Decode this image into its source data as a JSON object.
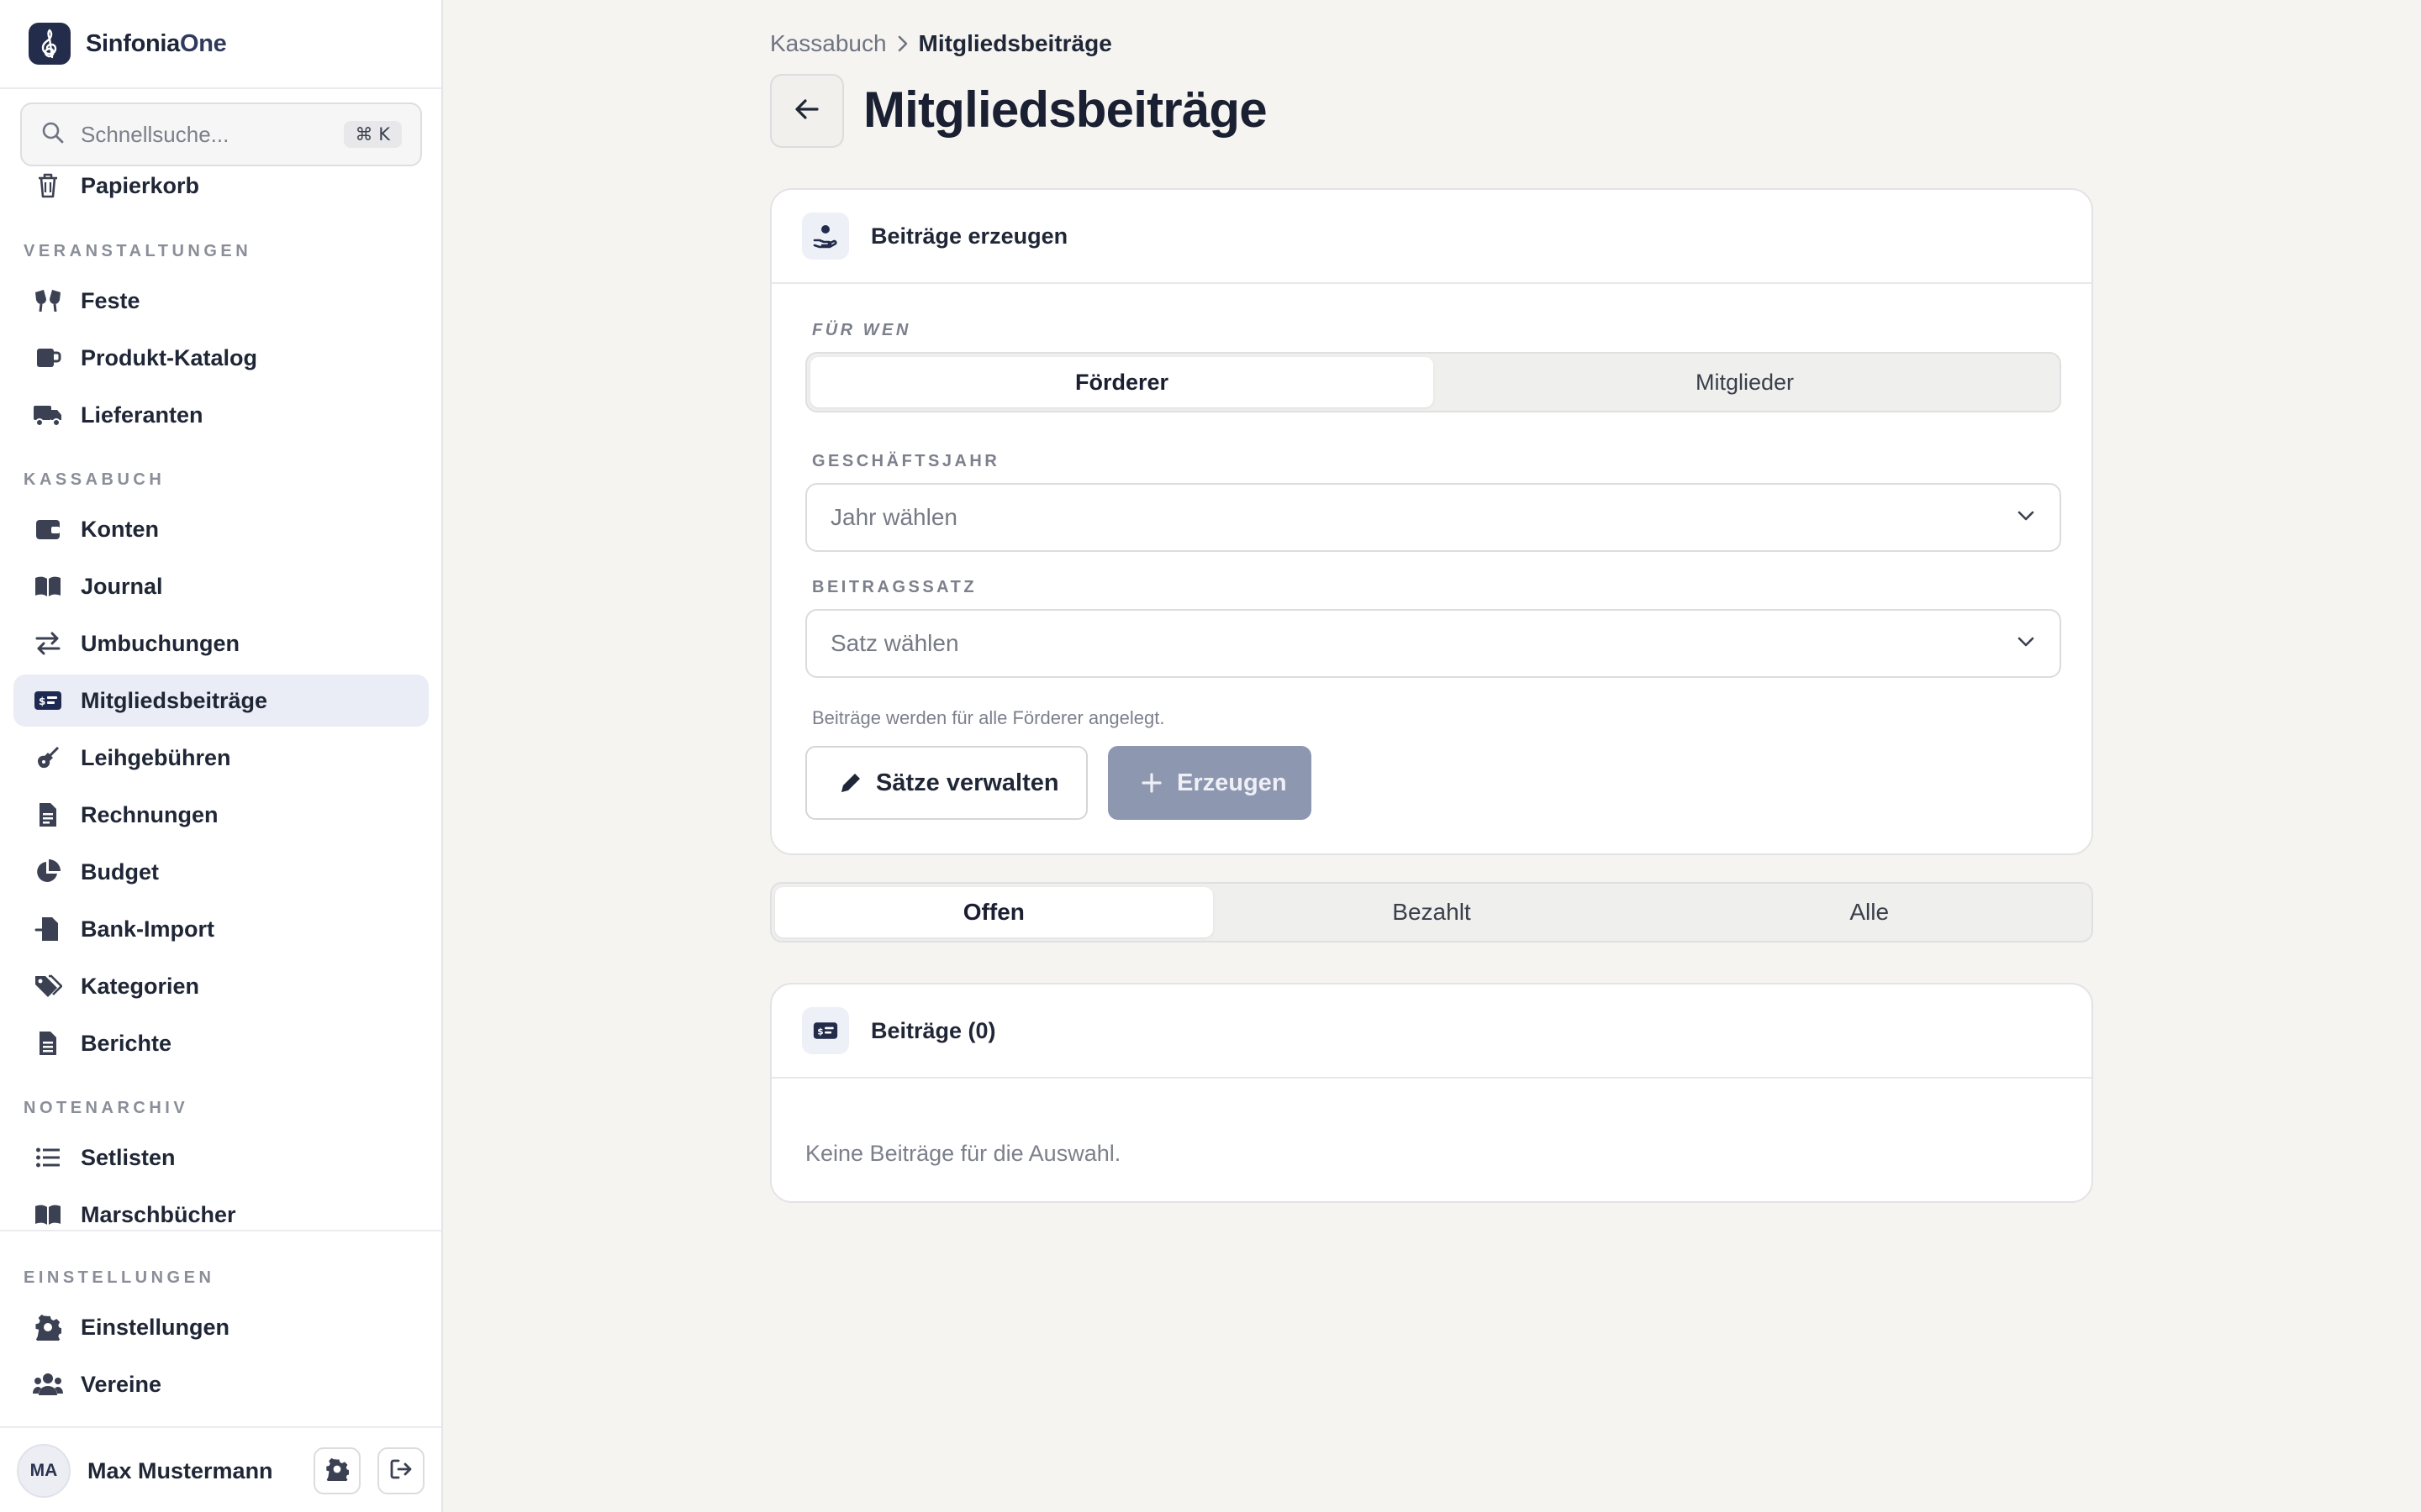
{
  "brand": {
    "name_main": "Sinfonia",
    "name_accent": "One"
  },
  "search": {
    "placeholder": "Schnellsuche...",
    "shortcut": "⌘ K"
  },
  "sidebar": {
    "items": {
      "papierkorb": "Papierkorb",
      "feste": "Feste",
      "produkt_katalog": "Produkt-Katalog",
      "lieferanten": "Lieferanten",
      "konten": "Konten",
      "journal": "Journal",
      "umbuchungen": "Umbuchungen",
      "mitgliedsbeitraege": "Mitgliedsbeiträge",
      "leihgebuehren": "Leihgebühren",
      "rechnungen": "Rechnungen",
      "budget": "Budget",
      "bank_import": "Bank-Import",
      "kategorien": "Kategorien",
      "berichte": "Berichte",
      "setlisten": "Setlisten",
      "marschbuecher": "Marschbücher",
      "einstellungen": "Einstellungen",
      "vereine": "Vereine"
    },
    "sections": {
      "veranstaltungen": "VERANSTALTUNGEN",
      "kassabuch": "KASSABUCH",
      "notenarchiv": "NOTENARCHIV",
      "einstellungen": "EINSTELLUNGEN"
    },
    "active_item": "mitgliedsbeitraege"
  },
  "user": {
    "initials": "MA",
    "name": "Max Mustermann"
  },
  "breadcrumb": {
    "parent": "Kassabuch",
    "current": "Mitgliedsbeiträge"
  },
  "page": {
    "title": "Mitgliedsbeiträge"
  },
  "generate_card": {
    "title": "Beiträge erzeugen",
    "for_whom_label": "FÜR WEN",
    "for_whom_options": [
      "Förderer",
      "Mitglieder"
    ],
    "for_whom_selected": "Förderer",
    "year_label": "GESCHÄFTSJAHR",
    "year_placeholder": "Jahr wählen",
    "rate_label": "BEITRAGSSATZ",
    "rate_placeholder": "Satz wählen",
    "hint": "Beiträge werden für alle Förderer angelegt.",
    "manage_button": "Sätze verwalten",
    "generate_button": "Erzeugen"
  },
  "filter_tabs": {
    "options": [
      "Offen",
      "Bezahlt",
      "Alle"
    ],
    "selected": "Offen"
  },
  "list_card": {
    "title": "Beiträge (0)",
    "empty_text": "Keine Beiträge für die Auswahl."
  },
  "colors": {
    "accent": "#232c4a",
    "active_bg": "#eaedf6",
    "disabled_button": "#8e97b0",
    "background": "#f5f4f1"
  }
}
